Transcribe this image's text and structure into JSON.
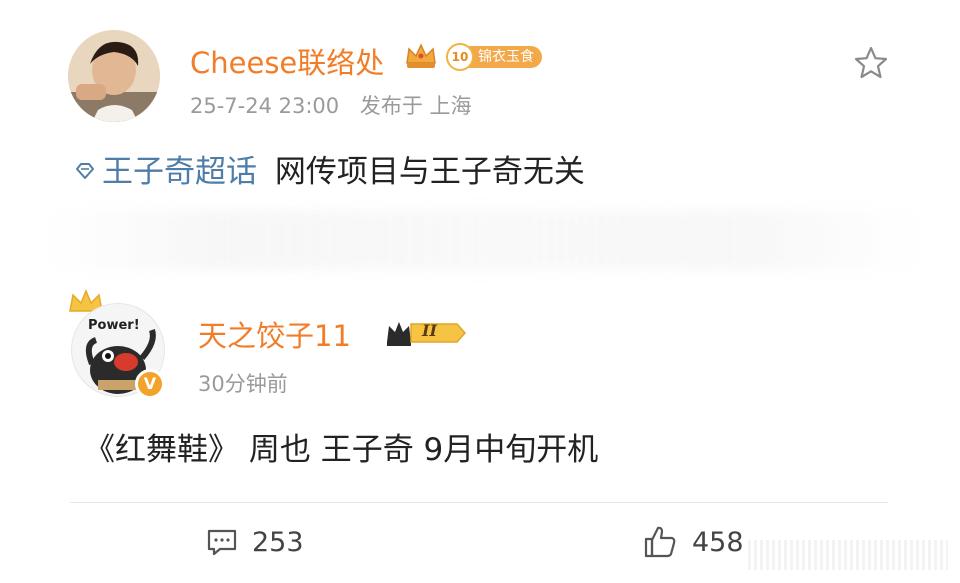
{
  "post": {
    "author": "Cheese联络处",
    "level": "10",
    "level_title": "锦衣玉食",
    "timestamp": "25-7-24 23:00",
    "published_at": "发布于 上海",
    "topic": "王子奇超话",
    "text": "网传项目与王子奇无关"
  },
  "reply": {
    "author": "天之饺子11",
    "rank": "II",
    "avatar_text": "Power!",
    "verified": "V",
    "time_ago": "30分钟前",
    "text": "《红舞鞋》 周也  王子奇 9月中旬开机"
  },
  "actions": {
    "comments": "253",
    "likes": "458"
  },
  "colors": {
    "username": "#f27d28",
    "topic": "#4e7ea8",
    "meta": "#9a9a9a",
    "badge": "#f3a94a"
  }
}
